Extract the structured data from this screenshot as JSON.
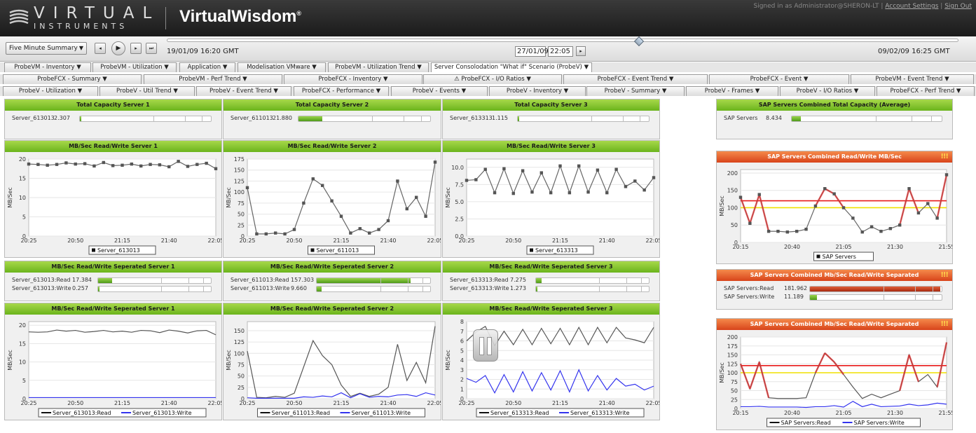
{
  "header": {
    "brand_top": "VIRTUAL",
    "brand_bottom": "INSTRUMENTS",
    "product": "VirtualWisdom",
    "product_mark": "®",
    "signed_in": "Signed in as Administrator@SHERON-LT",
    "account_settings": "Account Settings",
    "separator": "|",
    "sign_out": "Sign Out"
  },
  "toolbar": {
    "summary_select": "Five Minute Summary",
    "start_time": "19/01/09 16:20 GMT",
    "end_time": "09/02/09 16:25 GMT",
    "current_date": "27/01/09",
    "current_time": "22:05",
    "slider_position_fraction": 0.38
  },
  "tabs": {
    "row1": [
      "ProbeVM - Inventory ▼",
      "ProbeVM - Utilization ▼",
      "Application ▼",
      "Modelisation VMware ▼",
      "ProbeVM - Utilization Trend ▼",
      "Server Consolodation \"What if\" Scenario (ProbeV) ▼"
    ],
    "row2": [
      "ProbeFCX - Summary ▼",
      "ProbeVM - Perf Trend ▼",
      "ProbeFCX - Inventory ▼",
      "⚠ ProbeFCX - I/O Ratios ▼",
      "ProbeFCX - Event Trend ▼",
      "ProbeFCX - Event ▼",
      "ProbeVM - Event Trend ▼"
    ],
    "row3": [
      "ProbeV - Utilization ▼",
      "ProbeV - Util Trend ▼",
      "ProbeV - Event Trend ▼",
      "ProbeFCX - Performance ▼",
      "ProbeV - Events ▼",
      "ProbeV - Inventory ▼",
      "ProbeV - Summary ▼",
      "ProbeV - Frames ▼",
      "ProbeV - I/O Ratios ▼",
      "ProbeFCX - Perf Trend ▼"
    ]
  },
  "gauges": {
    "cap1": {
      "title": "Total Capacity Server 1",
      "rows": [
        {
          "label": "Server_613013",
          "value": "2.307",
          "frac": 0.01
        }
      ]
    },
    "cap2": {
      "title": "Total Capacity Server 2",
      "rows": [
        {
          "label": "Server_611013",
          "value": "21.880",
          "frac": 0.18
        }
      ]
    },
    "cap3": {
      "title": "Total Capacity Server 3",
      "rows": [
        {
          "label": "Server_613313",
          "value": "1.115",
          "frac": 0.005
        }
      ]
    },
    "capsap": {
      "title": "SAP Servers Combined Total Capacity (Average)",
      "rows": [
        {
          "label": "SAP Servers",
          "value": "8.434",
          "frac": 0.06
        }
      ]
    },
    "sep1": {
      "title": "MB/Sec Read/Write Seperated Server 1",
      "rows": [
        {
          "label": "Server_613013:Read",
          "value": "17.384",
          "frac": 0.12
        },
        {
          "label": "Server_613013:Write",
          "value": "0.257",
          "frac": 0.002
        }
      ]
    },
    "sep2": {
      "title": "MB/Sec Read/Write Seperated Server 2",
      "rows": [
        {
          "label": "Server_611013:Read",
          "value": "157.303",
          "frac": 0.82
        },
        {
          "label": "Server_611013:Write",
          "value": "9.660",
          "frac": 0.04
        }
      ]
    },
    "sep3": {
      "title": "MB/Sec Read/Write Seperated Server 3",
      "rows": [
        {
          "label": "Server_613313:Read",
          "value": "7.275",
          "frac": 0.05
        },
        {
          "label": "Server_613313:Write",
          "value": "1.273",
          "frac": 0.005
        }
      ]
    },
    "sepsap": {
      "title": "SAP Servers Combined Mb/Sec Read/Write Separated",
      "bang": "!!!",
      "rows": [
        {
          "label": "SAP Servers:Read",
          "value": "181.962",
          "frac": 0.98,
          "red": true
        },
        {
          "label": "SAP Servers:Write",
          "value": "11.189",
          "frac": 0.05
        }
      ]
    }
  },
  "chart_data": [
    {
      "id": "rw1",
      "type": "line",
      "title": "MB/Sec Read/Write Server 1",
      "ylabel": "MB/Sec",
      "ylim": [
        0,
        20
      ],
      "yticks": [
        0,
        5,
        10,
        15,
        20
      ],
      "x_ticks": [
        "20:25",
        "20:50",
        "21:15",
        "21:40",
        "22:05"
      ],
      "markers": true,
      "legend": "bottom",
      "series": [
        {
          "name": "Server_613013",
          "color": "#666666",
          "values": [
            18.7,
            18.6,
            18.4,
            18.6,
            19.0,
            18.7,
            18.8,
            18.2,
            19.1,
            18.3,
            18.4,
            18.7,
            18.2,
            18.6,
            18.5,
            18.0,
            19.4,
            18.1,
            18.6,
            18.9,
            17.5
          ]
        }
      ]
    },
    {
      "id": "rw2",
      "type": "line",
      "title": "MB/Sec Read/Write Server 2",
      "ylabel": "MB/Sec",
      "ylim": [
        0,
        175
      ],
      "yticks": [
        0,
        25,
        50,
        75,
        100,
        125,
        150,
        175
      ],
      "x_ticks": [
        "20:25",
        "20:50",
        "21:15",
        "21:40",
        "22:05"
      ],
      "markers": true,
      "legend": "bottom",
      "series": [
        {
          "name": "Server_611013",
          "color": "#666666",
          "values": [
            110,
            5,
            5,
            7,
            5,
            15,
            75,
            130,
            115,
            80,
            45,
            7,
            17,
            7,
            15,
            35,
            125,
            62,
            88,
            45,
            168
          ]
        }
      ]
    },
    {
      "id": "rw3",
      "type": "line",
      "title": "MB/Sec Read/Write Server 3",
      "ylabel": "MB/Sec",
      "ylim": [
        0,
        11.2
      ],
      "yticks": [
        0.0,
        2.5,
        5.0,
        7.5,
        10.0
      ],
      "x_ticks": [
        "20:25",
        "20:50",
        "21:15",
        "21:40",
        "22:05"
      ],
      "markers": true,
      "legend": "bottom",
      "series": [
        {
          "name": "Server_613313",
          "color": "#666666",
          "values": [
            8.1,
            8.2,
            9.7,
            6.3,
            9.8,
            6.2,
            9.5,
            6.4,
            9.2,
            6.3,
            10.2,
            6.3,
            10.2,
            6.4,
            9.6,
            6.3,
            9.7,
            7.2,
            8.0,
            6.7,
            8.5
          ]
        }
      ]
    },
    {
      "id": "rwsap",
      "type": "line",
      "title": "SAP Servers Combined Read/Write MB/Sec",
      "bang": "!!!",
      "ylabel": "MB/Sec",
      "ylim": [
        0,
        210
      ],
      "yticks": [
        0,
        50,
        100,
        150,
        200
      ],
      "x_ticks": [
        "20:15",
        "20:40",
        "21:05",
        "21:30",
        "21:55"
      ],
      "thresholds": [
        {
          "value": 120,
          "color": "#e81a1a"
        },
        {
          "value": 100,
          "color": "#f0e000"
        }
      ],
      "markers": true,
      "legend": "bottom",
      "series": [
        {
          "name": "SAP Servers",
          "color": "#666666",
          "values": [
            130,
            55,
            138,
            32,
            32,
            30,
            32,
            38,
            105,
            155,
            140,
            100,
            70,
            30,
            45,
            32,
            40,
            50,
            155,
            85,
            112,
            70,
            195
          ]
        }
      ]
    },
    {
      "id": "sepc1",
      "type": "line",
      "title": "MB/Sec Read/Write Seperated Server 1",
      "ylabel": "MB/Sec",
      "ylim": [
        0,
        21
      ],
      "yticks": [
        0,
        5,
        10,
        15,
        20
      ],
      "x_ticks": [
        "20:25",
        "20:50",
        "21:15",
        "21:40",
        "22:05"
      ],
      "legend": "bottom",
      "series": [
        {
          "name": "Server_613013:Read",
          "color": "#555555",
          "values": [
            18.2,
            18.1,
            18.2,
            18.7,
            18.4,
            18.6,
            18.1,
            18.3,
            18.6,
            18.2,
            18.4,
            18.1,
            18.6,
            18.5,
            18.0,
            18.7,
            18.4,
            17.9,
            18.5,
            18.6,
            17.4
          ]
        },
        {
          "name": "Server_613013:Write",
          "color": "#3333ee",
          "values": [
            0.3,
            0.3,
            0.3,
            0.3,
            0.3,
            0.3,
            0.3,
            0.3,
            0.3,
            0.3,
            0.3,
            0.3,
            0.3,
            0.3,
            0.3,
            0.3,
            0.3,
            0.3,
            0.3,
            0.3,
            0.3
          ]
        }
      ]
    },
    {
      "id": "sepc2",
      "type": "line",
      "title": "MB/Sec Read/Write Seperated Server 2",
      "ylabel": "MB/Sec",
      "ylim": [
        0,
        170
      ],
      "yticks": [
        0,
        25,
        50,
        75,
        100,
        125,
        150
      ],
      "x_ticks": [
        "20:25",
        "20:50",
        "21:15",
        "21:40",
        "22:05"
      ],
      "legend": "bottom",
      "series": [
        {
          "name": "Server_611013:Read",
          "color": "#555555",
          "values": [
            105,
            3,
            2,
            5,
            3,
            12,
            70,
            128,
            95,
            75,
            30,
            5,
            12,
            5,
            10,
            25,
            120,
            40,
            80,
            35,
            160
          ]
        },
        {
          "name": "Server_611013:Write",
          "color": "#3333ee",
          "values": [
            2,
            1,
            1,
            1,
            1,
            1,
            4,
            3,
            6,
            4,
            13,
            2,
            11,
            3,
            5,
            4,
            8,
            9,
            5,
            13,
            8
          ]
        }
      ]
    },
    {
      "id": "sepc3",
      "type": "line",
      "title": "MB/Sec Read/Write Seperated Server 3",
      "ylabel": "MB/Sec",
      "ylim": [
        0,
        8
      ],
      "yticks": [
        0,
        1,
        2,
        3,
        4,
        5,
        6,
        7,
        8
      ],
      "x_ticks": [
        "20:25",
        "20:50",
        "21:15",
        "21:40",
        "22:05"
      ],
      "legend": "bottom",
      "series": [
        {
          "name": "Server_613313:Read",
          "color": "#555555",
          "values": [
            6.0,
            6.9,
            7.5,
            5.5,
            7.0,
            5.6,
            7.2,
            5.6,
            7.3,
            5.7,
            7.3,
            5.6,
            7.4,
            5.6,
            7.4,
            5.8,
            7.4,
            6.3,
            6.1,
            5.8,
            7.4
          ]
        },
        {
          "name": "Server_613313:Write",
          "color": "#3333ee",
          "values": [
            2.1,
            1.7,
            2.4,
            0.6,
            2.5,
            0.7,
            2.8,
            0.8,
            2.7,
            0.9,
            2.9,
            0.7,
            3.0,
            0.8,
            2.4,
            0.9,
            2.1,
            1.3,
            1.5,
            0.9,
            1.3
          ]
        }
      ]
    },
    {
      "id": "sepcsap",
      "type": "line",
      "title": "SAP Servers Combined Mb/Sec Read/Write Separated",
      "bang": "!!!",
      "ylabel": "MB/Sec",
      "ylim": [
        0,
        200
      ],
      "yticks": [
        0,
        25,
        50,
        75,
        100,
        125,
        150,
        175,
        200
      ],
      "x_ticks": [
        "20:15",
        "20:40",
        "21:05",
        "21:30",
        "21:55"
      ],
      "thresholds": [
        {
          "value": 120,
          "color": "#e81a1a"
        },
        {
          "value": 100,
          "color": "#f0e000"
        }
      ],
      "legend": "bottom",
      "series": [
        {
          "name": "SAP Servers:Read",
          "color": "#555555",
          "values": [
            125,
            55,
            130,
            30,
            28,
            28,
            28,
            30,
            100,
            155,
            130,
            95,
            60,
            28,
            40,
            30,
            40,
            50,
            150,
            75,
            95,
            60,
            185
          ]
        },
        {
          "name": "SAP Servers:Write",
          "color": "#3333ee",
          "values": [
            5,
            5,
            6,
            4,
            4,
            4,
            4,
            3,
            5,
            5,
            8,
            4,
            20,
            5,
            12,
            5,
            6,
            7,
            12,
            8,
            10,
            15,
            12
          ]
        }
      ]
    }
  ]
}
